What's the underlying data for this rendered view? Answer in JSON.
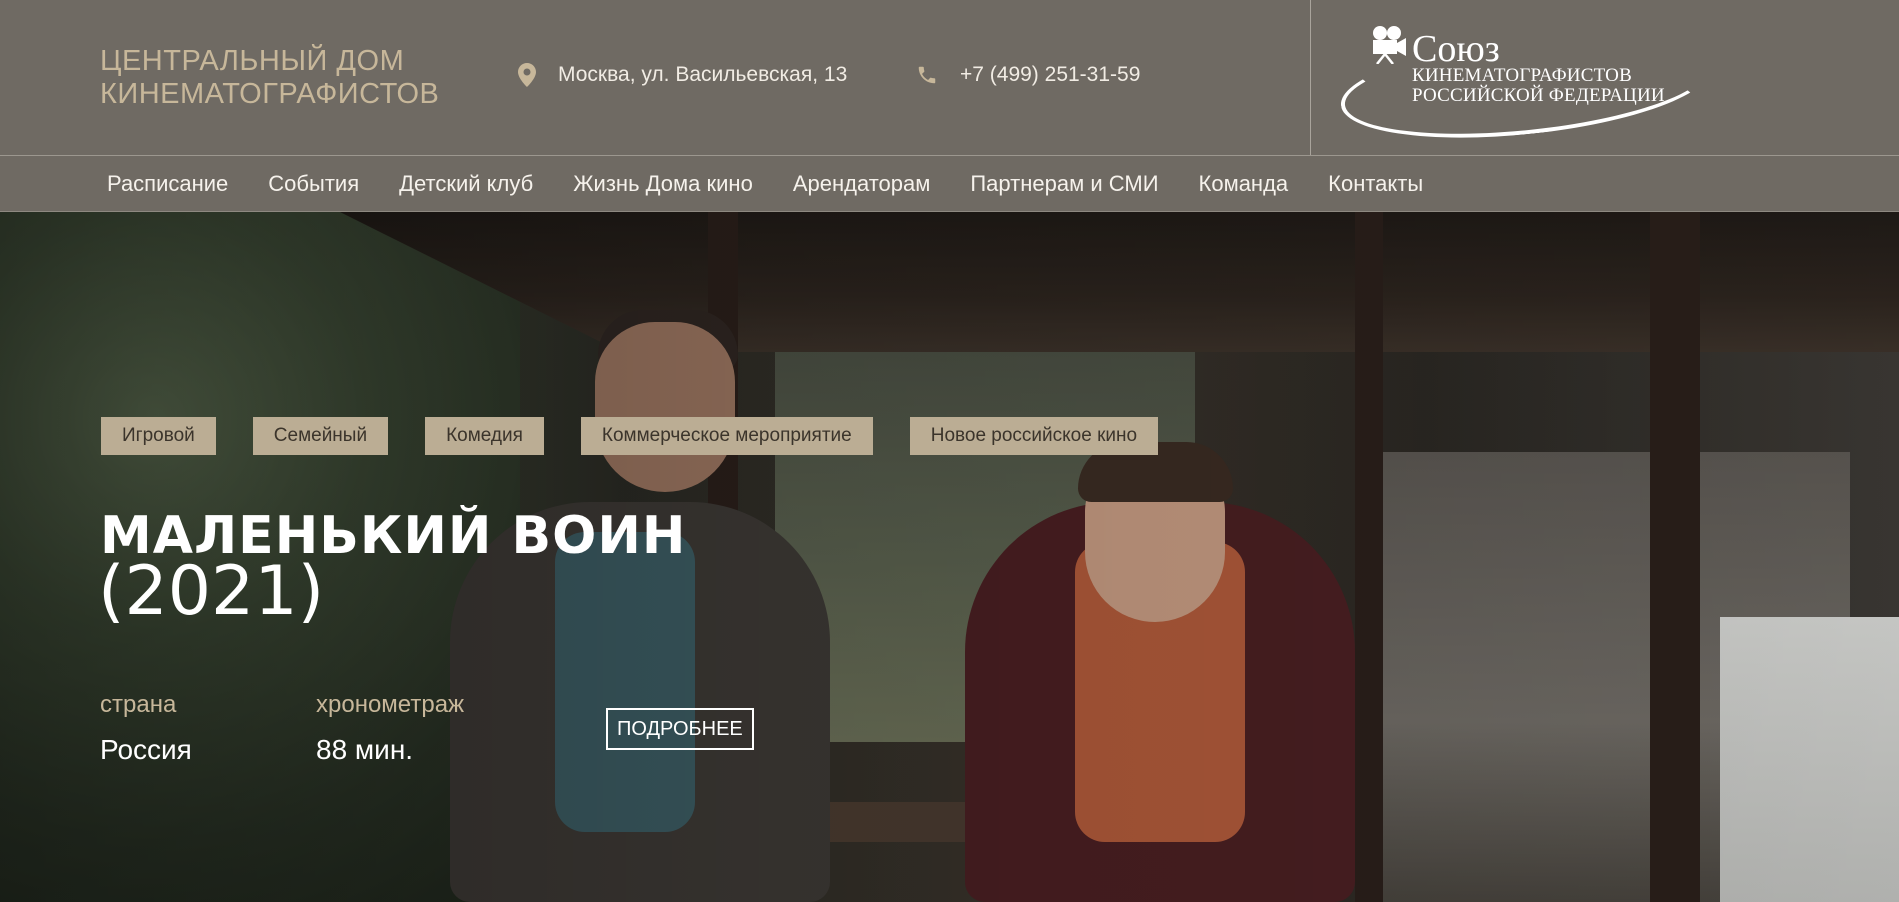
{
  "header": {
    "site_title_line1": "ЦЕНТРАЛЬНЫЙ ДОМ",
    "site_title_line2": "КИНЕМАТОГРАФИСТОВ",
    "address": "Москва, ул. Васильевская, 13",
    "phone": "+7 (499) 251-31-59",
    "logo": {
      "title": "Союз",
      "subtitle_line1": "Кинематографистов",
      "subtitle_line2": "Российской федерации"
    },
    "colors": {
      "bar": "#6f6a63",
      "title": "#c7b79a"
    }
  },
  "nav": {
    "items": [
      {
        "label": "Расписание"
      },
      {
        "label": "События"
      },
      {
        "label": "Детский клуб"
      },
      {
        "label": "Жизнь Дома кино"
      },
      {
        "label": "Арендаторам"
      },
      {
        "label": "Партнерам и СМИ"
      },
      {
        "label": "Команда"
      },
      {
        "label": "Контакты"
      }
    ]
  },
  "hero": {
    "tags": [
      {
        "label": "Игровой"
      },
      {
        "label": "Семейный"
      },
      {
        "label": "Комедия"
      },
      {
        "label": "Коммерческое мероприятие"
      },
      {
        "label": "Новое российское кино"
      }
    ],
    "title": "МАЛЕНЬКИЙ ВОИН",
    "year": "(2021)",
    "country_label": "страна",
    "country_value": "Россия",
    "duration_label": "хронометраж",
    "duration_value": "88 мин.",
    "more_button": "ПОДРОБНЕЕ",
    "colors": {
      "tag_bg": "#bbad94",
      "label": "#c7b79a"
    }
  },
  "icons": {
    "address": "map-pin-icon",
    "phone": "phone-icon",
    "logo": "film-camera-icon"
  }
}
